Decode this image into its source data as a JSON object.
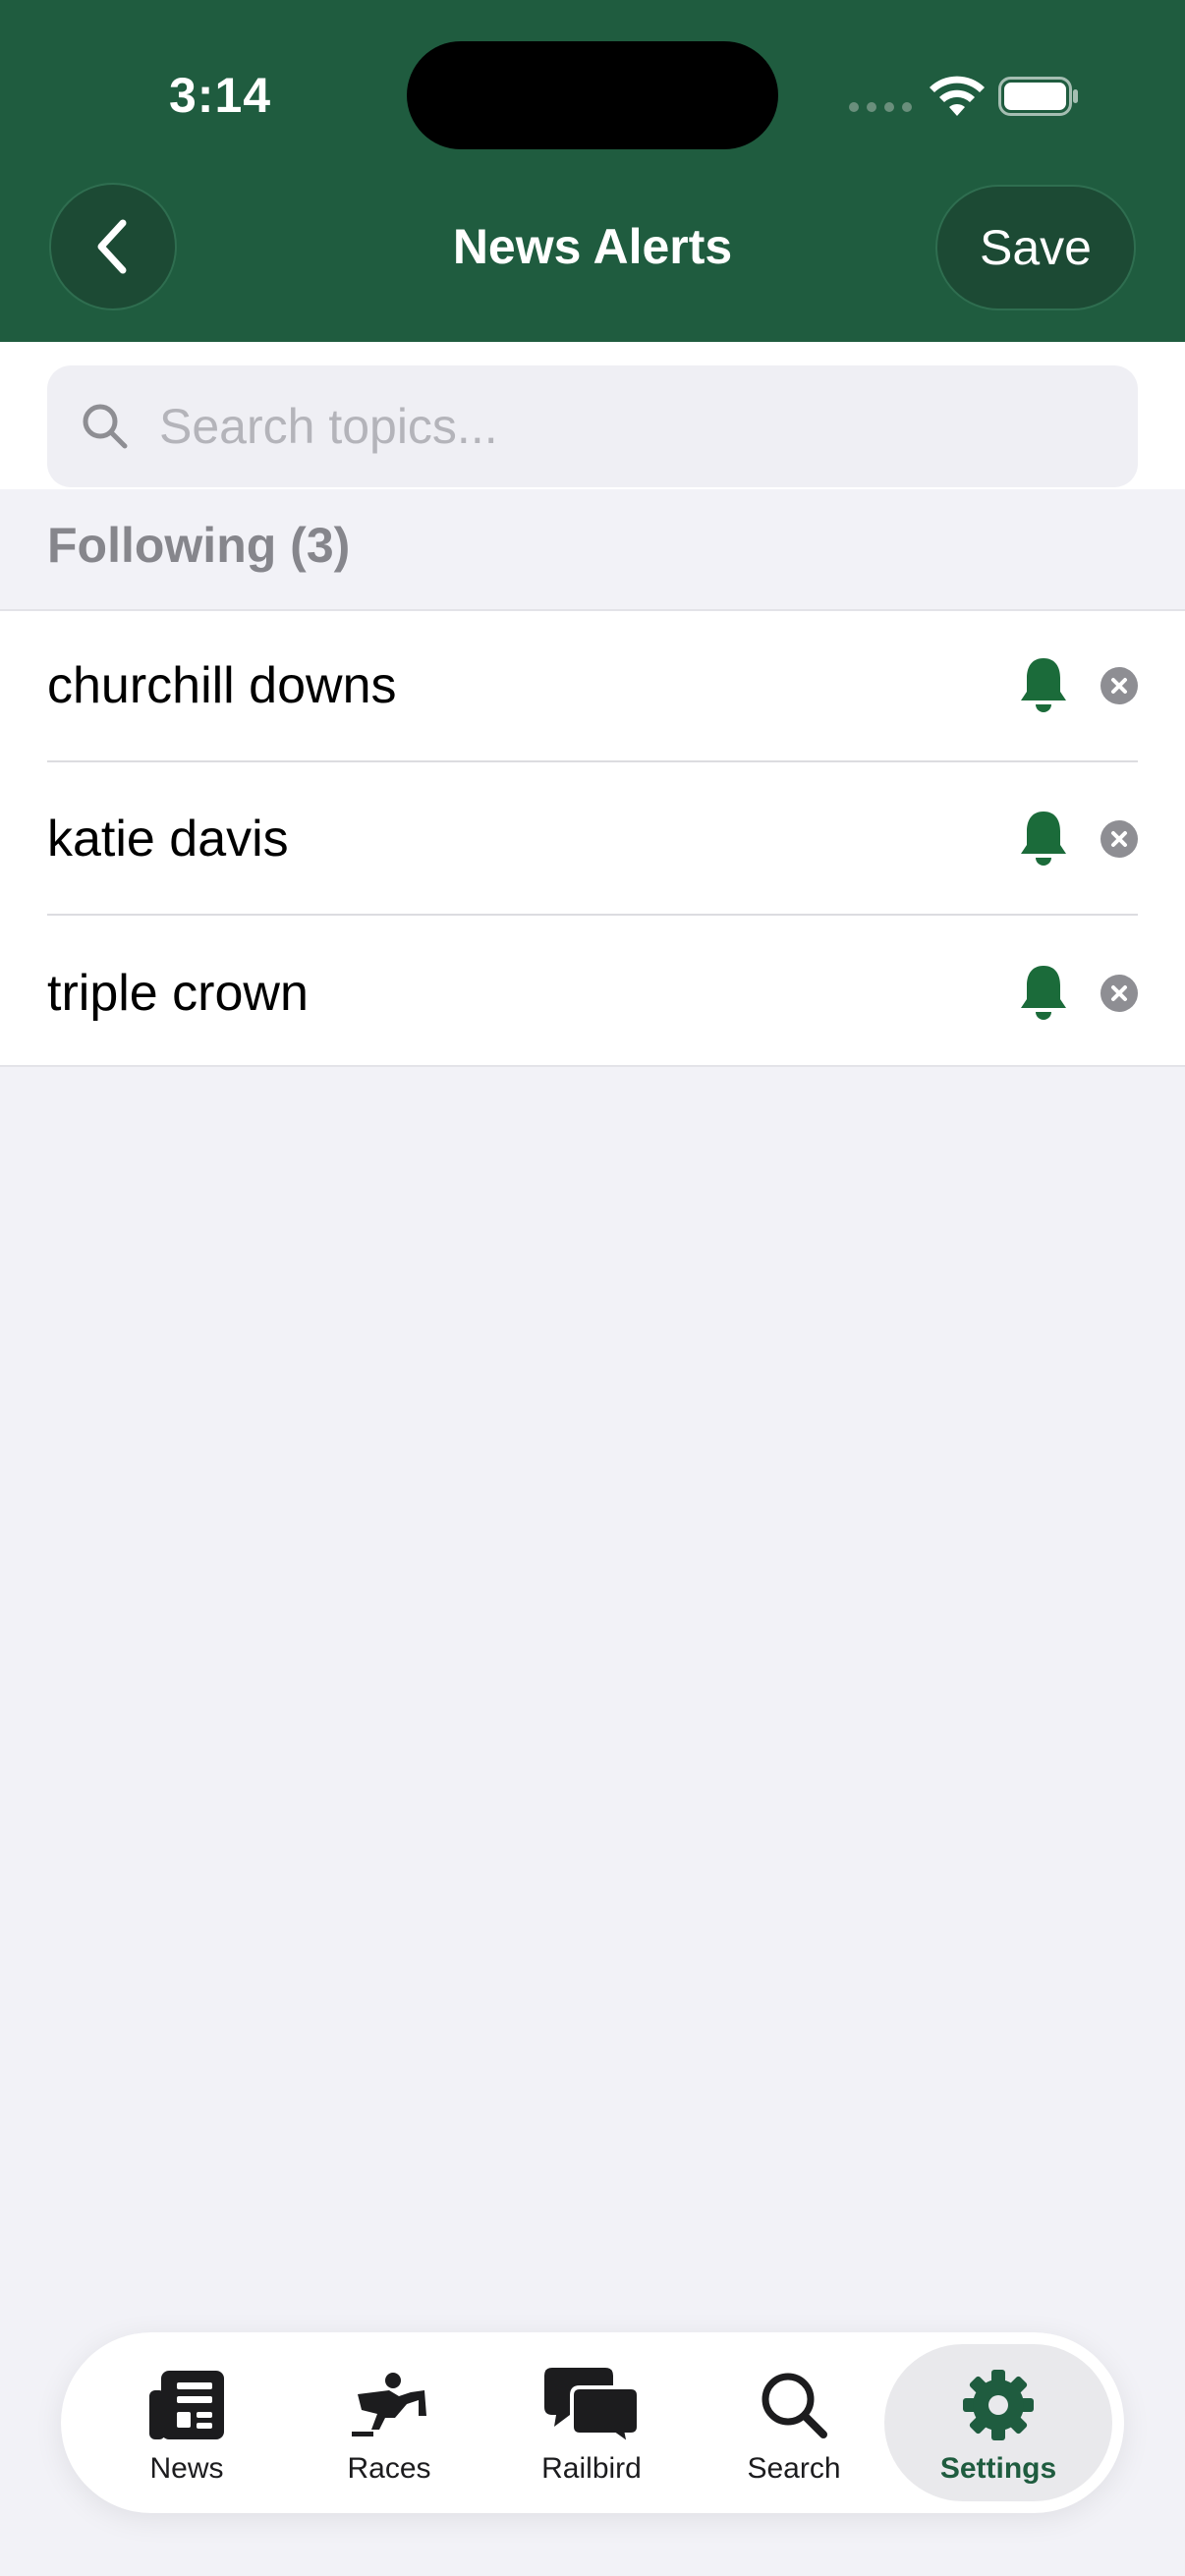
{
  "status_bar": {
    "time": "3:14"
  },
  "nav": {
    "title": "News Alerts",
    "save_label": "Save"
  },
  "search": {
    "placeholder": "Search topics..."
  },
  "section": {
    "title": "Following (3)"
  },
  "topics": [
    {
      "label": "churchill downs"
    },
    {
      "label": "katie davis"
    },
    {
      "label": "triple crown"
    }
  ],
  "tabs": [
    {
      "label": "News",
      "icon": "newspaper-icon"
    },
    {
      "label": "Races",
      "icon": "horse-racing-icon"
    },
    {
      "label": "Railbird",
      "icon": "chat-bubbles-icon"
    },
    {
      "label": "Search",
      "icon": "search-icon"
    },
    {
      "label": "Settings",
      "icon": "gear-icon",
      "active": true
    }
  ],
  "colors": {
    "brand": "#1f5c3f",
    "accent_green": "#1b6b3a",
    "gray": "#8e8e93"
  }
}
